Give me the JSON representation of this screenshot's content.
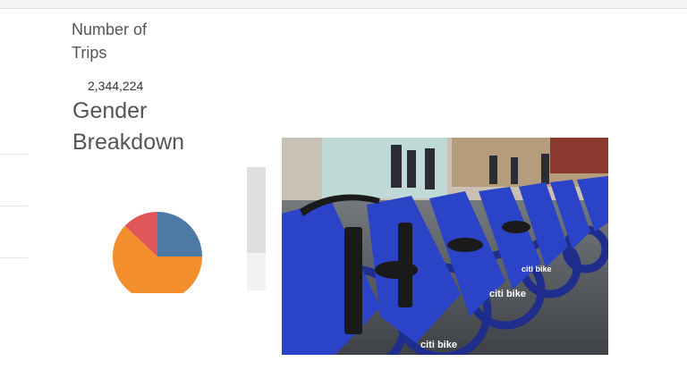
{
  "metric": {
    "label": "Number of Trips",
    "value": "2,344,224"
  },
  "gender": {
    "title": "Gender Breakdown"
  },
  "chart_data": {
    "type": "pie",
    "slices": [
      {
        "value": 25,
        "color": "#4e79a7"
      },
      {
        "value": 62,
        "color": "#f28e2b"
      },
      {
        "value": 13,
        "color": "#e15759"
      }
    ]
  },
  "image": {
    "brand_text": "citi bike"
  },
  "colors": {
    "accent_blue": "#4e79a7",
    "accent_orange": "#f28e2b",
    "accent_red": "#e15759"
  }
}
